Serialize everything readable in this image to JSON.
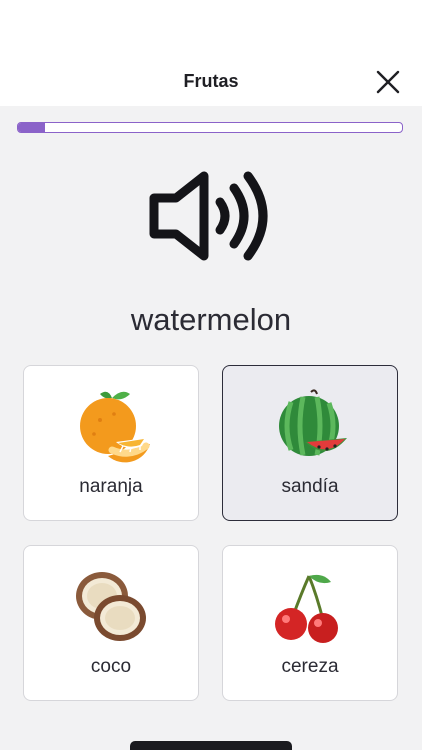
{
  "header": {
    "title": "Frutas"
  },
  "progress": {
    "fraction": 0.07
  },
  "prompt": {
    "word": "watermelon"
  },
  "choices": [
    {
      "label": "naranja",
      "icon": "orange-icon",
      "selected": false
    },
    {
      "label": "sandía",
      "icon": "watermelon-icon",
      "selected": true
    },
    {
      "label": "coco",
      "icon": "coconut-icon",
      "selected": false
    },
    {
      "label": "cereza",
      "icon": "cherry-icon",
      "selected": false
    }
  ],
  "colors": {
    "accent": "#8b63c9",
    "background": "#f2f2f3",
    "text": "#2b2b34"
  }
}
